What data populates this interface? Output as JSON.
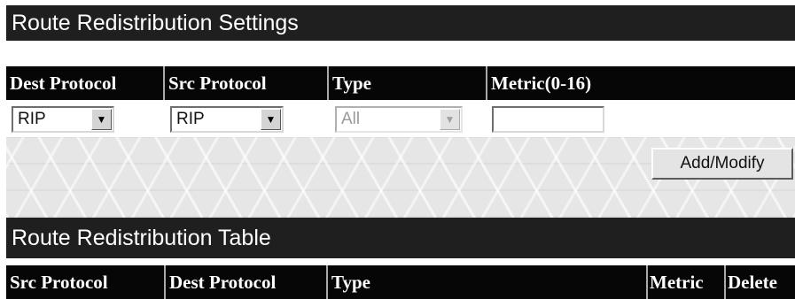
{
  "settings_panel": {
    "title": "Route Redistribution Settings",
    "columns": {
      "dest_protocol": "Dest Protocol",
      "src_protocol": "Src Protocol",
      "type": "Type",
      "metric": "Metric(0-16)"
    },
    "dest_protocol_select": {
      "value": "RIP"
    },
    "src_protocol_select": {
      "value": "RIP"
    },
    "type_select": {
      "value": "All",
      "disabled": true
    },
    "metric_input": {
      "value": ""
    },
    "add_modify_button": "Add/Modify"
  },
  "table_panel": {
    "title": "Route Redistribution Table",
    "columns": {
      "src_protocol": "Src Protocol",
      "dest_protocol": "Dest Protocol",
      "type": "Type",
      "metric": "Metric",
      "delete": "Delete"
    }
  },
  "colors": {
    "title_bar": "#1f1f1f",
    "header_row": "#060606",
    "button_face": "#e4e4e4"
  },
  "icons": {
    "select_arrow": "chevron-down-icon"
  }
}
